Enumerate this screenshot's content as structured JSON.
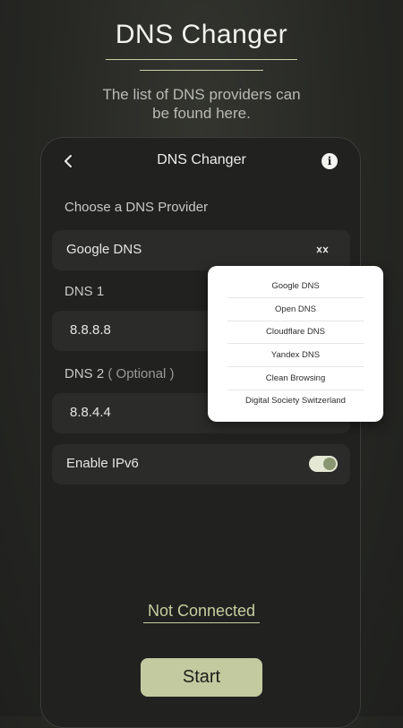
{
  "hero": {
    "title": "DNS Changer",
    "subtitle": "The list of DNS providers can be found here."
  },
  "appbar": {
    "title": "DNS Changer",
    "back_icon": "chevron-left-icon",
    "info_icon": "info-icon",
    "info_glyph": "i"
  },
  "provider": {
    "label": "Choose a DNS Provider",
    "selected": "Google DNS",
    "dropdown_icon": "double-chevron-icon"
  },
  "dns1": {
    "label": "DNS 1",
    "value": "8.8.8.8"
  },
  "dns2": {
    "label": "DNS 2",
    "optional": "( Optional )",
    "value": "8.8.4.4"
  },
  "ipv6": {
    "label": "Enable IPv6",
    "enabled": true
  },
  "dropdown": {
    "options": [
      "Google DNS",
      "Open DNS",
      "Cloudflare DNS",
      "Yandex DNS",
      "Clean Browsing",
      "Digital Society Switzerland"
    ]
  },
  "status": {
    "text": "Not Connected"
  },
  "start_button": {
    "label": "Start"
  },
  "colors": {
    "accent": "#c3caa0",
    "background": "#262723",
    "card": "#212120",
    "field": "#2b2b29"
  }
}
